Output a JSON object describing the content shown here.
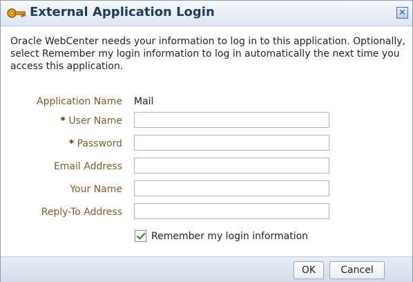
{
  "dialog": {
    "title": "External Application Login",
    "close_symbol": "✕",
    "description": "Oracle WebCenter needs your information to log in to this application. Optionally, select Remember my login information to log in automatically the next time you access this application."
  },
  "form": {
    "application_name_label": "Application Name",
    "application_name_value": "Mail",
    "required_marker": "*",
    "user_name_label": "User Name",
    "user_name_value": "",
    "password_label": "Password",
    "password_value": "",
    "email_label": "Email Address",
    "email_value": "",
    "your_name_label": "Your Name",
    "your_name_value": "",
    "reply_to_label": "Reply-To Address",
    "reply_to_value": ""
  },
  "remember": {
    "label": "Remember my login information",
    "checked": true
  },
  "buttons": {
    "ok_label": "OK",
    "cancel_label": "Cancel"
  },
  "icons": {
    "title_icon": "key-icon",
    "close_icon": "close-icon",
    "checkbox_icon": "checkmark-icon"
  },
  "colors": {
    "title_text": "#203a5c",
    "label_text": "#7b5b2f",
    "checkmark": "#2e8b2e"
  }
}
